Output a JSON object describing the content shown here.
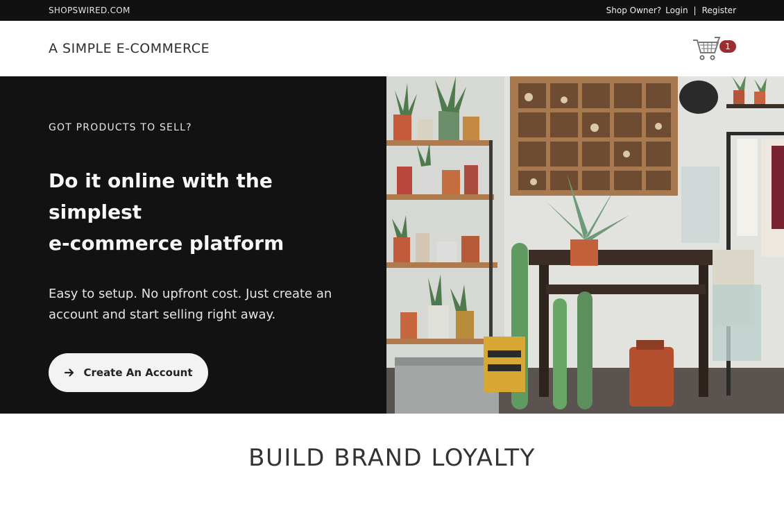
{
  "topbar": {
    "site": "SHOPSWIRED.COM",
    "shop_owner": "Shop Owner?",
    "login": "Login",
    "separator": "|",
    "register": "Register"
  },
  "header": {
    "title": "A SIMPLE E-COMMERCE",
    "cart_count": "1",
    "cart_icon": "shopping-cart-icon"
  },
  "hero": {
    "eyebrow": "GOT PRODUCTS TO SELL?",
    "headline_line1": "Do it online with the simplest",
    "headline_line2": "e-commerce platform",
    "lead_line1": "Easy to setup. No upfront cost. Just create an",
    "lead_line2": "account and start selling right away.",
    "cta_label": "Create An Account",
    "cta_icon": "arrow-right-icon"
  },
  "section": {
    "title": "BUILD BRAND LOYALTY"
  },
  "colors": {
    "topbar_bg": "#111111",
    "hero_bg": "#131213",
    "badge": "#9c2d33",
    "separator": "#e45b63"
  }
}
